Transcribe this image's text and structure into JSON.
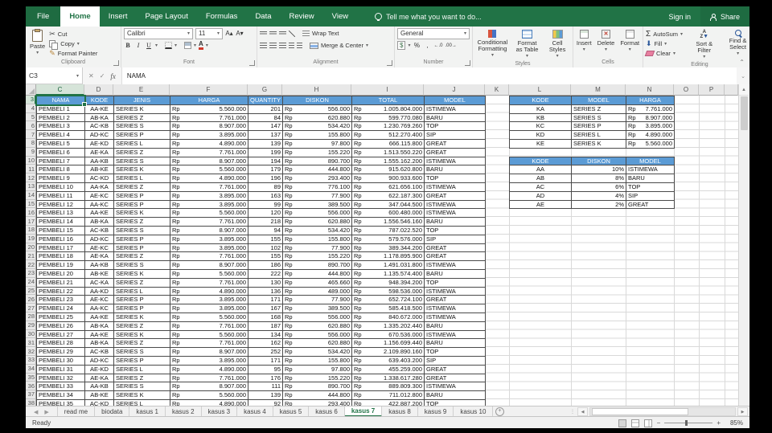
{
  "titlebar": {
    "tabs": [
      "File",
      "Home",
      "Insert",
      "Page Layout",
      "Formulas",
      "Data",
      "Review",
      "View"
    ],
    "active_tab": "Home",
    "tell_me": "Tell me what you want to do...",
    "sign_in": "Sign in",
    "share": "Share"
  },
  "ribbon": {
    "clipboard": {
      "label": "Clipboard",
      "paste": "Paste",
      "cut": "Cut",
      "copy": "Copy",
      "format_painter": "Format Painter"
    },
    "font": {
      "label": "Font",
      "font_name": "Calibri",
      "font_size": "11",
      "bold": "B",
      "italic": "I",
      "underline": "U"
    },
    "alignment": {
      "label": "Alignment",
      "wrap_text": "Wrap Text",
      "merge_center": "Merge & Center"
    },
    "number": {
      "label": "Number",
      "format": "General",
      "percent": "%",
      "comma": ",",
      "inc_dec": "←.0",
      "dec_dec": ".00→"
    },
    "styles": {
      "label": "Styles",
      "conditional": "Conditional Formatting",
      "format_table": "Format as Table",
      "cell_styles": "Cell Styles"
    },
    "cells": {
      "label": "Cells",
      "insert": "Insert",
      "delete": "Delete",
      "format": "Format"
    },
    "editing": {
      "label": "Editing",
      "autosum": "AutoSum",
      "fill": "Fill",
      "clear": "Clear",
      "sort_filter": "Sort & Filter",
      "find_select": "Find & Select"
    }
  },
  "formula_bar": {
    "name_box": "C3",
    "fx_label": "fx",
    "formula": "NAMA"
  },
  "grid": {
    "column_letters": [
      "C",
      "D",
      "E",
      "F",
      "G",
      "H",
      "I",
      "J",
      "K",
      "L",
      "M",
      "N",
      "O",
      "P"
    ],
    "row_start": 3,
    "row_end": 38,
    "selected_cell": {
      "column": "C",
      "row": 3
    },
    "main_table": {
      "headers": [
        "NAMA",
        "KODE",
        "JENIS",
        "HARGA",
        "QUANTITY",
        "DISKON",
        "TOTAL",
        "MODEL"
      ],
      "currency_prefix": "Rp",
      "rows": [
        [
          "PEMBELI 1",
          "AA-KE",
          "SERIES K",
          "5.560.000",
          "201",
          "556.000",
          "1.005.804.000",
          "ISTIMEWA"
        ],
        [
          "PEMBELI 2",
          "AB-KA",
          "SERIES Z",
          "7.761.000",
          "84",
          "620.880",
          "599.770.080",
          "BARU"
        ],
        [
          "PEMBELI 3",
          "AC-KB",
          "SERIES S",
          "8.907.000",
          "147",
          "534.420",
          "1.230.769.260",
          "TOP"
        ],
        [
          "PEMBELI 4",
          "AD-KC",
          "SERIES P",
          "3.895.000",
          "137",
          "155.800",
          "512.270.400",
          "SIP"
        ],
        [
          "PEMBELI 5",
          "AE-KD",
          "SERIES L",
          "4.890.000",
          "139",
          "97.800",
          "666.115.800",
          "GREAT"
        ],
        [
          "PEMBELI 6",
          "AE-KA",
          "SERIES Z",
          "7.761.000",
          "199",
          "155.220",
          "1.513.550.220",
          "GREAT"
        ],
        [
          "PEMBELI 7",
          "AA-KB",
          "SERIES S",
          "8.907.000",
          "194",
          "890.700",
          "1.555.162.200",
          "ISTIMEWA"
        ],
        [
          "PEMBELI 8",
          "AB-KE",
          "SERIES K",
          "5.560.000",
          "179",
          "444.800",
          "915.620.800",
          "BARU"
        ],
        [
          "PEMBELI 9",
          "AC-KD",
          "SERIES L",
          "4.890.000",
          "196",
          "293.400",
          "900.933.600",
          "TOP"
        ],
        [
          "PEMBELI 10",
          "AA-KA",
          "SERIES Z",
          "7.761.000",
          "89",
          "776.100",
          "621.656.100",
          "ISTIMEWA"
        ],
        [
          "PEMBELI 11",
          "AE-KC",
          "SERIES P",
          "3.895.000",
          "163",
          "77.900",
          "622.187.300",
          "GREAT"
        ],
        [
          "PEMBELI 12",
          "AA-KC",
          "SERIES P",
          "3.895.000",
          "99",
          "389.500",
          "347.044.500",
          "ISTIMEWA"
        ],
        [
          "PEMBELI 13",
          "AA-KE",
          "SERIES K",
          "5.560.000",
          "120",
          "556.000",
          "600.480.000",
          "ISTIMEWA"
        ],
        [
          "PEMBELI 14",
          "AB-KA",
          "SERIES Z",
          "7.761.000",
          "218",
          "620.880",
          "1.556.546.160",
          "BARU"
        ],
        [
          "PEMBELI 15",
          "AC-KB",
          "SERIES S",
          "8.907.000",
          "94",
          "534.420",
          "787.022.520",
          "TOP"
        ],
        [
          "PEMBELI 16",
          "AD-KC",
          "SERIES P",
          "3.895.000",
          "155",
          "155.800",
          "579.576.000",
          "SIP"
        ],
        [
          "PEMBELI 17",
          "AE-KC",
          "SERIES P",
          "3.895.000",
          "102",
          "77.900",
          "389.344.200",
          "GREAT"
        ],
        [
          "PEMBELI 18",
          "AE-KA",
          "SERIES Z",
          "7.761.000",
          "155",
          "155.220",
          "1.178.895.900",
          "GREAT"
        ],
        [
          "PEMBELI 19",
          "AA-KB",
          "SERIES S",
          "8.907.000",
          "186",
          "890.700",
          "1.491.031.800",
          "ISTIMEWA"
        ],
        [
          "PEMBELI 20",
          "AB-KE",
          "SERIES K",
          "5.560.000",
          "222",
          "444.800",
          "1.135.574.400",
          "BARU"
        ],
        [
          "PEMBELI 21",
          "AC-KA",
          "SERIES Z",
          "7.761.000",
          "130",
          "465.660",
          "948.394.200",
          "TOP"
        ],
        [
          "PEMBELI 22",
          "AA-KD",
          "SERIES L",
          "4.890.000",
          "136",
          "489.000",
          "598.536.000",
          "ISTIMEWA"
        ],
        [
          "PEMBELI 23",
          "AE-KC",
          "SERIES P",
          "3.895.000",
          "171",
          "77.900",
          "652.724.100",
          "GREAT"
        ],
        [
          "PEMBELI 24",
          "AA-KC",
          "SERIES P",
          "3.895.000",
          "167",
          "389.500",
          "585.418.500",
          "ISTIMEWA"
        ],
        [
          "PEMBELI 25",
          "AA-KE",
          "SERIES K",
          "5.560.000",
          "168",
          "556.000",
          "840.672.000",
          "ISTIMEWA"
        ],
        [
          "PEMBELI 26",
          "AB-KA",
          "SERIES Z",
          "7.761.000",
          "187",
          "620.880",
          "1.335.202.440",
          "BARU"
        ],
        [
          "PEMBELI 27",
          "AA-KE",
          "SERIES K",
          "5.560.000",
          "134",
          "556.000",
          "670.536.000",
          "ISTIMEWA"
        ],
        [
          "PEMBELI 28",
          "AB-KA",
          "SERIES Z",
          "7.761.000",
          "162",
          "620.880",
          "1.156.699.440",
          "BARU"
        ],
        [
          "PEMBELI 29",
          "AC-KB",
          "SERIES S",
          "8.907.000",
          "252",
          "534.420",
          "2.109.890.160",
          "TOP"
        ],
        [
          "PEMBELI 30",
          "AD-KC",
          "SERIES P",
          "3.895.000",
          "171",
          "155.800",
          "639.403.200",
          "SIP"
        ],
        [
          "PEMBELI 31",
          "AE-KD",
          "SERIES L",
          "4.890.000",
          "95",
          "97.800",
          "455.259.000",
          "GREAT"
        ],
        [
          "PEMBELI 32",
          "AE-KA",
          "SERIES Z",
          "7.761.000",
          "176",
          "155.220",
          "1.338.617.280",
          "GREAT"
        ],
        [
          "PEMBELI 33",
          "AA-KB",
          "SERIES S",
          "8.907.000",
          "111",
          "890.700",
          "889.809.300",
          "ISTIMEWA"
        ],
        [
          "PEMBELI 34",
          "AB-KE",
          "SERIES K",
          "5.560.000",
          "139",
          "444.800",
          "711.012.800",
          "BARU"
        ],
        [
          "PEMBELI 35",
          "AC-KD",
          "SERIES L",
          "4.890.000",
          "92",
          "293.400",
          "422.887.200",
          "TOP"
        ]
      ]
    },
    "lookup_price": {
      "headers": [
        "KODE",
        "MODEL",
        "HARGA"
      ],
      "rows": [
        [
          "KA",
          "SERIES Z",
          "7.761.000"
        ],
        [
          "KB",
          "SERIES S",
          "8.907.000"
        ],
        [
          "KC",
          "SERIES P",
          "3.895.000"
        ],
        [
          "KD",
          "SERIES L",
          "4.890.000"
        ],
        [
          "KE",
          "SERIES K",
          "5.560.000"
        ]
      ]
    },
    "lookup_discount": {
      "headers": [
        "KODE",
        "DISKON",
        "MODEL"
      ],
      "rows": [
        [
          "AA",
          "10%",
          "ISTIMEWA"
        ],
        [
          "AB",
          "8%",
          "BARU"
        ],
        [
          "AC",
          "6%",
          "TOP"
        ],
        [
          "AD",
          "4%",
          "SIP"
        ],
        [
          "AE",
          "2%",
          "GREAT"
        ]
      ]
    }
  },
  "sheet_bar": {
    "tabs": [
      "read me",
      "biodata",
      "kasus 1",
      "kasus 2",
      "kasus 3",
      "kasus 4",
      "kasus 5",
      "kasus 6",
      "kasus 7",
      "kasus 8",
      "kasus 9",
      "kasus 10"
    ],
    "active": "kasus 7"
  },
  "status_bar": {
    "status": "Ready",
    "zoom": "85%"
  },
  "colors": {
    "accent_green": "#217346",
    "header_blue": "#5b9bd5"
  }
}
